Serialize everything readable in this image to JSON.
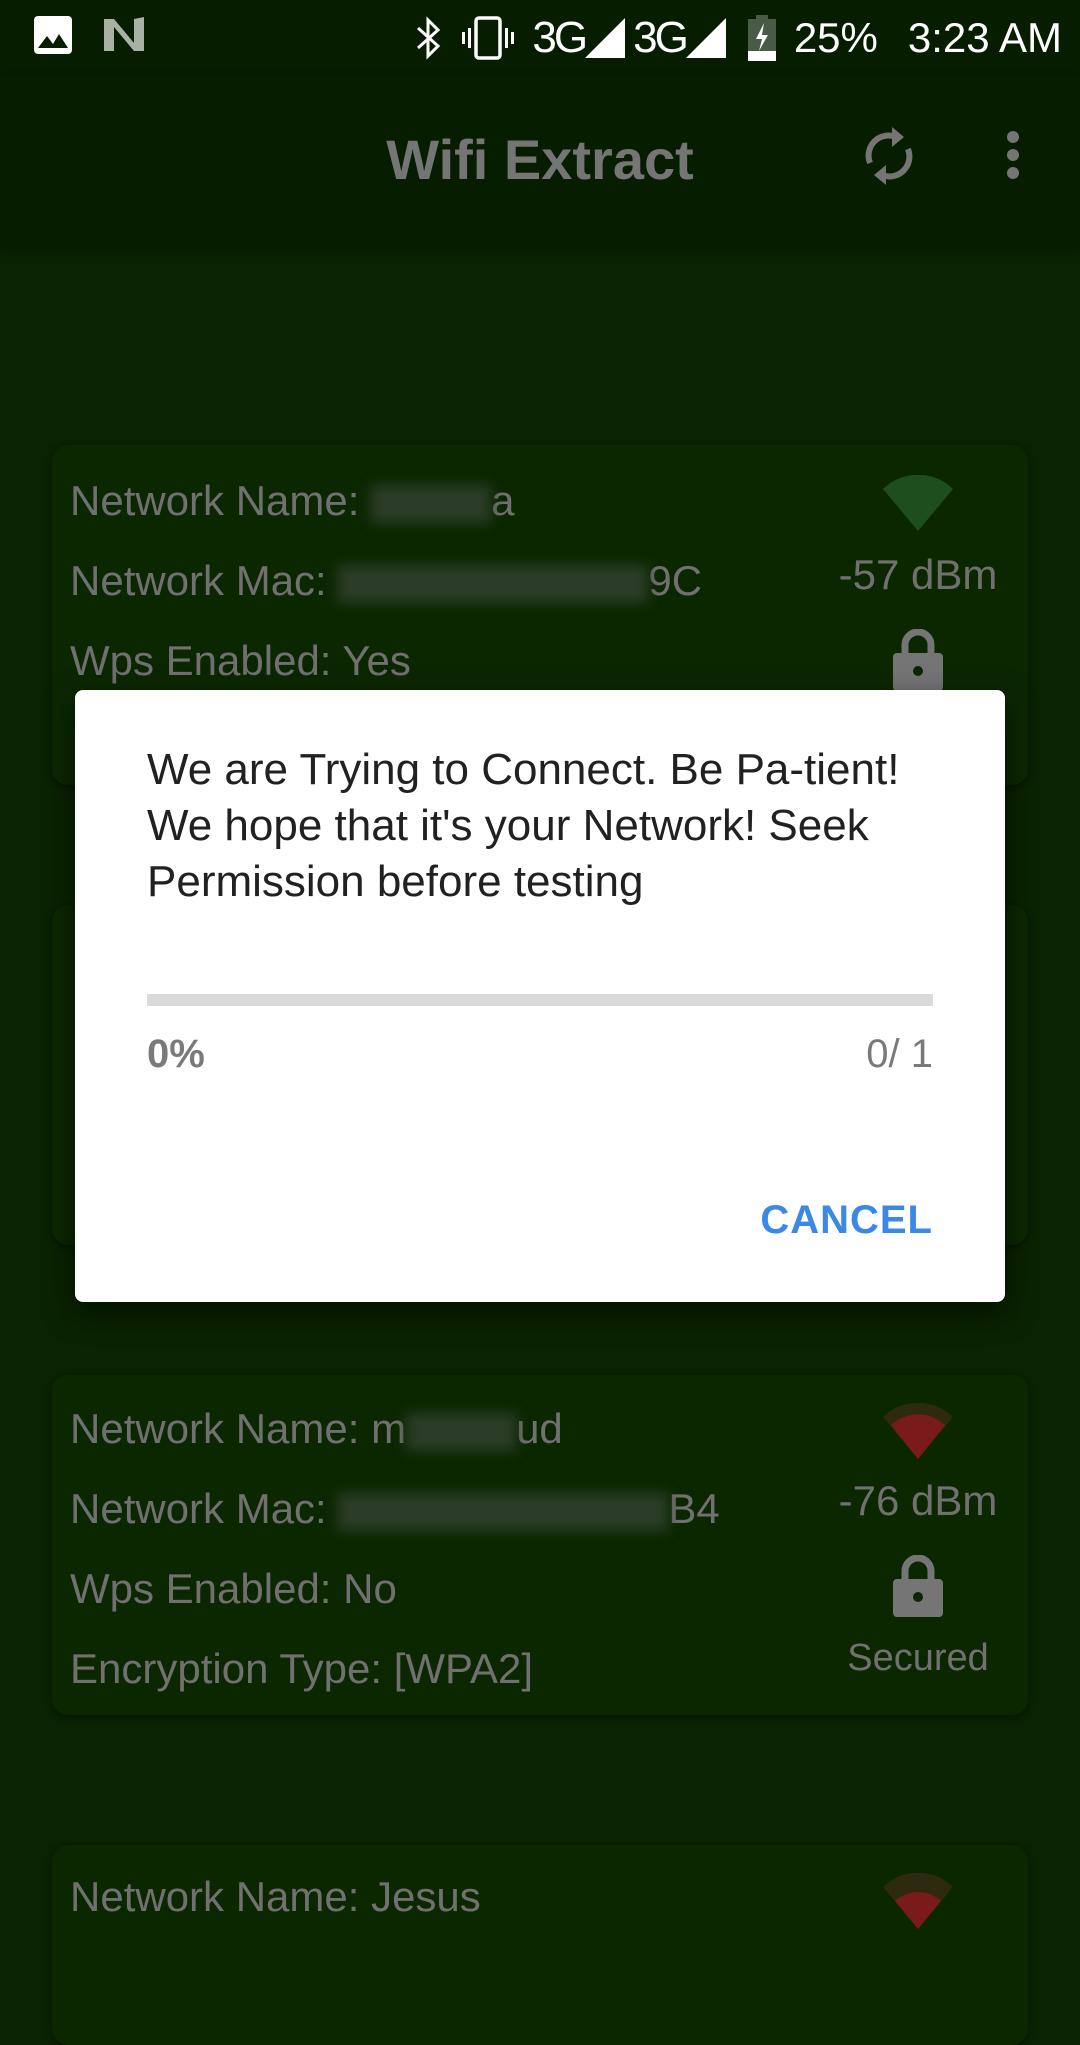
{
  "status_bar": {
    "icons_left": [
      "image-icon",
      "n-logo-icon"
    ],
    "icons_right": [
      "bluetooth-icon",
      "vibrate-icon"
    ],
    "network_1": "3G",
    "network_2": "3G",
    "battery": "25%",
    "time": "3:23 AM"
  },
  "app_bar": {
    "title": "Wifi Extract",
    "refresh_icon": "refresh-icon",
    "menu_icon": "more-vert-icon"
  },
  "networks": [
    {
      "name_label": "Network Name: ",
      "name_visible_suffix": "a",
      "mac_label": "Network Mac: ",
      "mac_visible_suffix": "9C",
      "wps": "Wps Enabled: Yes",
      "signal": "-57 dBm",
      "signal_color": "#1e4d1e",
      "signal_level": "strong",
      "lock_icon": "lock-icon"
    },
    {
      "name_label": "Network Name: ",
      "name_visible_prefix": "m",
      "name_visible_suffix": "ud",
      "mac_label": "Network Mac: ",
      "mac_visible_suffix": "B4",
      "wps": "Wps Enabled: No",
      "encryption": "Encryption Type: [WPA2]",
      "signal": "-76 dBm",
      "signal_color": "#7a1a1a",
      "signal_level": "weak",
      "lock_icon": "lock-icon",
      "security_status": "Secured"
    },
    {
      "name": "Network Name: Jesus",
      "signal_color": "#7a1a1a",
      "signal_level": "weak"
    }
  ],
  "dialog": {
    "message": "We are Trying to Connect. Be Pa-tient! We hope that it's your Network! Seek Permission before testing",
    "progress_percent_label": "0%",
    "progress_value": 0,
    "progress_count": "0/ 1",
    "cancel_label": "CANCEL",
    "accent_color": "#3b88e6"
  }
}
